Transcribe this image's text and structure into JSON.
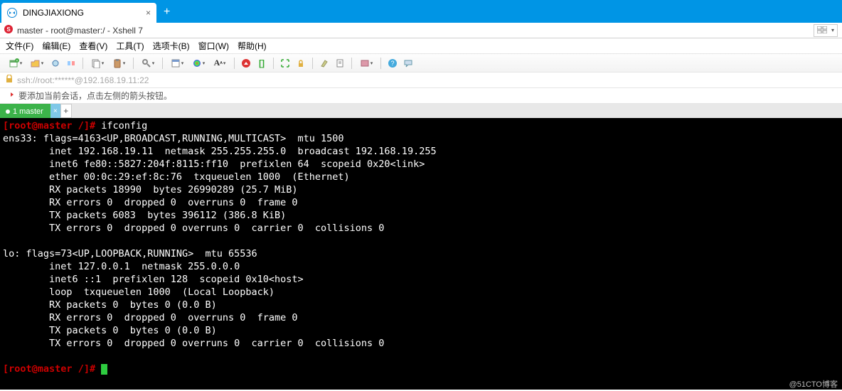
{
  "browser": {
    "tab_title": "DINGJIAXIONG",
    "close": "×",
    "new_tab": "+"
  },
  "title_bar": {
    "text": "master - root@master:/ - Xshell 7"
  },
  "menu": {
    "file": "文件(F)",
    "edit": "编辑(E)",
    "view": "查看(V)",
    "tools": "工具(T)",
    "tab": "选项卡(B)",
    "window": "窗口(W)",
    "help": "帮助(H)"
  },
  "ssh_bar": {
    "url": "ssh://root:******@192.168.19.11:22"
  },
  "hint_bar": {
    "text": "要添加当前会话，点击左侧的箭头按钮。"
  },
  "session_tab": {
    "label": "1 master",
    "close": "×",
    "add": "+"
  },
  "terminal": {
    "prompt_user": "root@master",
    "prompt_path": "/",
    "cmd1": "ifconfig",
    "l1": "ens33: flags=4163<UP,BROADCAST,RUNNING,MULTICAST>  mtu 1500",
    "l2": "        inet 192.168.19.11  netmask 255.255.255.0  broadcast 192.168.19.255",
    "l3": "        inet6 fe80::5827:204f:8115:ff10  prefixlen 64  scopeid 0x20<link>",
    "l4": "        ether 00:0c:29:ef:8c:76  txqueuelen 1000  (Ethernet)",
    "l5": "        RX packets 18990  bytes 26990289 (25.7 MiB)",
    "l6": "        RX errors 0  dropped 0  overruns 0  frame 0",
    "l7": "        TX packets 6083  bytes 396112 (386.8 KiB)",
    "l8": "        TX errors 0  dropped 0 overruns 0  carrier 0  collisions 0",
    "l9": "",
    "l10": "lo: flags=73<UP,LOOPBACK,RUNNING>  mtu 65536",
    "l11": "        inet 127.0.0.1  netmask 255.0.0.0",
    "l12": "        inet6 ::1  prefixlen 128  scopeid 0x10<host>",
    "l13": "        loop  txqueuelen 1000  (Local Loopback)",
    "l14": "        RX packets 0  bytes 0 (0.0 B)",
    "l15": "        RX errors 0  dropped 0  overruns 0  frame 0",
    "l16": "        TX packets 0  bytes 0 (0.0 B)",
    "l17": "        TX errors 0  dropped 0 overruns 0  carrier 0  collisions 0",
    "l18": ""
  },
  "watermark": "@51CTO博客"
}
